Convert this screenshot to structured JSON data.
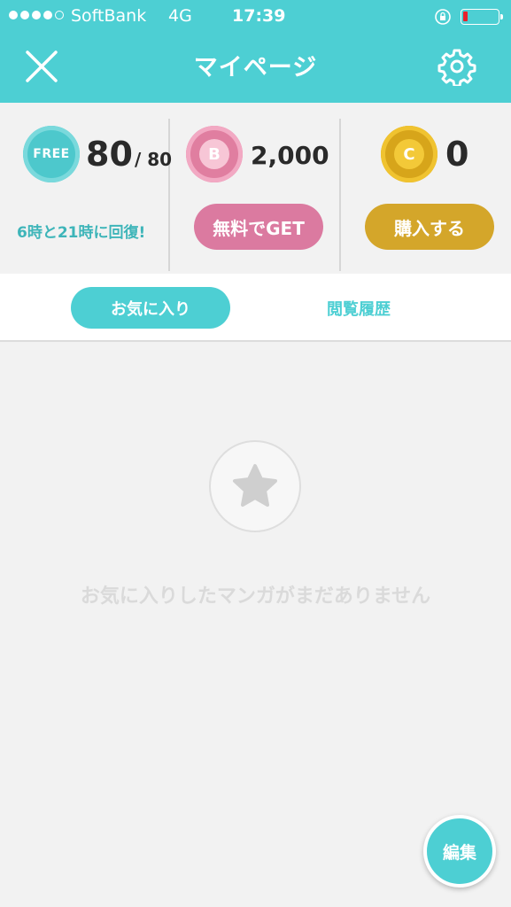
{
  "status_bar": {
    "carrier": "SoftBank",
    "network": "4G",
    "time": "17:39",
    "signal_bars": 4,
    "signal_max": 5
  },
  "nav": {
    "title": "マイページ",
    "close_icon": "close-icon",
    "settings_icon": "gear-icon"
  },
  "wallet": {
    "free": {
      "icon_label": "FREE",
      "count": "80",
      "max": "/ 80",
      "recover_text": "6時と21時に回復!",
      "color": "#4dc8cc"
    },
    "bonus": {
      "icon_label": "B",
      "count": "2,000",
      "button_label": "無料でGET",
      "color": "#db7aa0"
    },
    "coin": {
      "icon_label": "C",
      "count": "0",
      "button_label": "購入する",
      "color": "#d4a62a"
    }
  },
  "tabs": [
    {
      "label": "お気に入り",
      "active": true
    },
    {
      "label": "閲覧履歴",
      "active": false
    }
  ],
  "empty_state": {
    "icon": "star-icon",
    "message": "お気に入りしたマンガがまだありません"
  },
  "fab": {
    "label": "編集"
  },
  "colors": {
    "accent": "#4dcfd3",
    "background": "#f2f2f2"
  }
}
